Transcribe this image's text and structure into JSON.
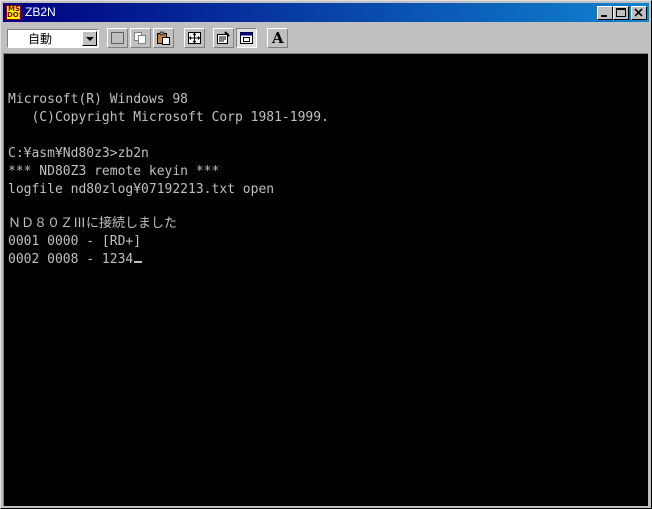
{
  "window": {
    "title": "ZB2N",
    "icon_text_top": "MS",
    "icon_text_bottom": "DOS"
  },
  "toolbar": {
    "font_size_value": "自動",
    "font_button_label": "A"
  },
  "console": {
    "lines": [
      "Microsoft(R) Windows 98",
      "   (C)Copyright Microsoft Corp 1981-1999.",
      "C:¥asm¥Nd80z3>zb2n",
      "*** ND80Z3 remote keyin ***",
      "logfile nd80zlog¥07192213.txt open",
      "ＮＤ８０ＺⅢに接続しました",
      "0001 0000 - [RD+]",
      "0002 0008 - 1234"
    ]
  },
  "colors": {
    "titlebar_start": "#000080",
    "titlebar_end": "#1084d0",
    "console_bg": "#000000",
    "console_text": "#c0c0c0"
  }
}
